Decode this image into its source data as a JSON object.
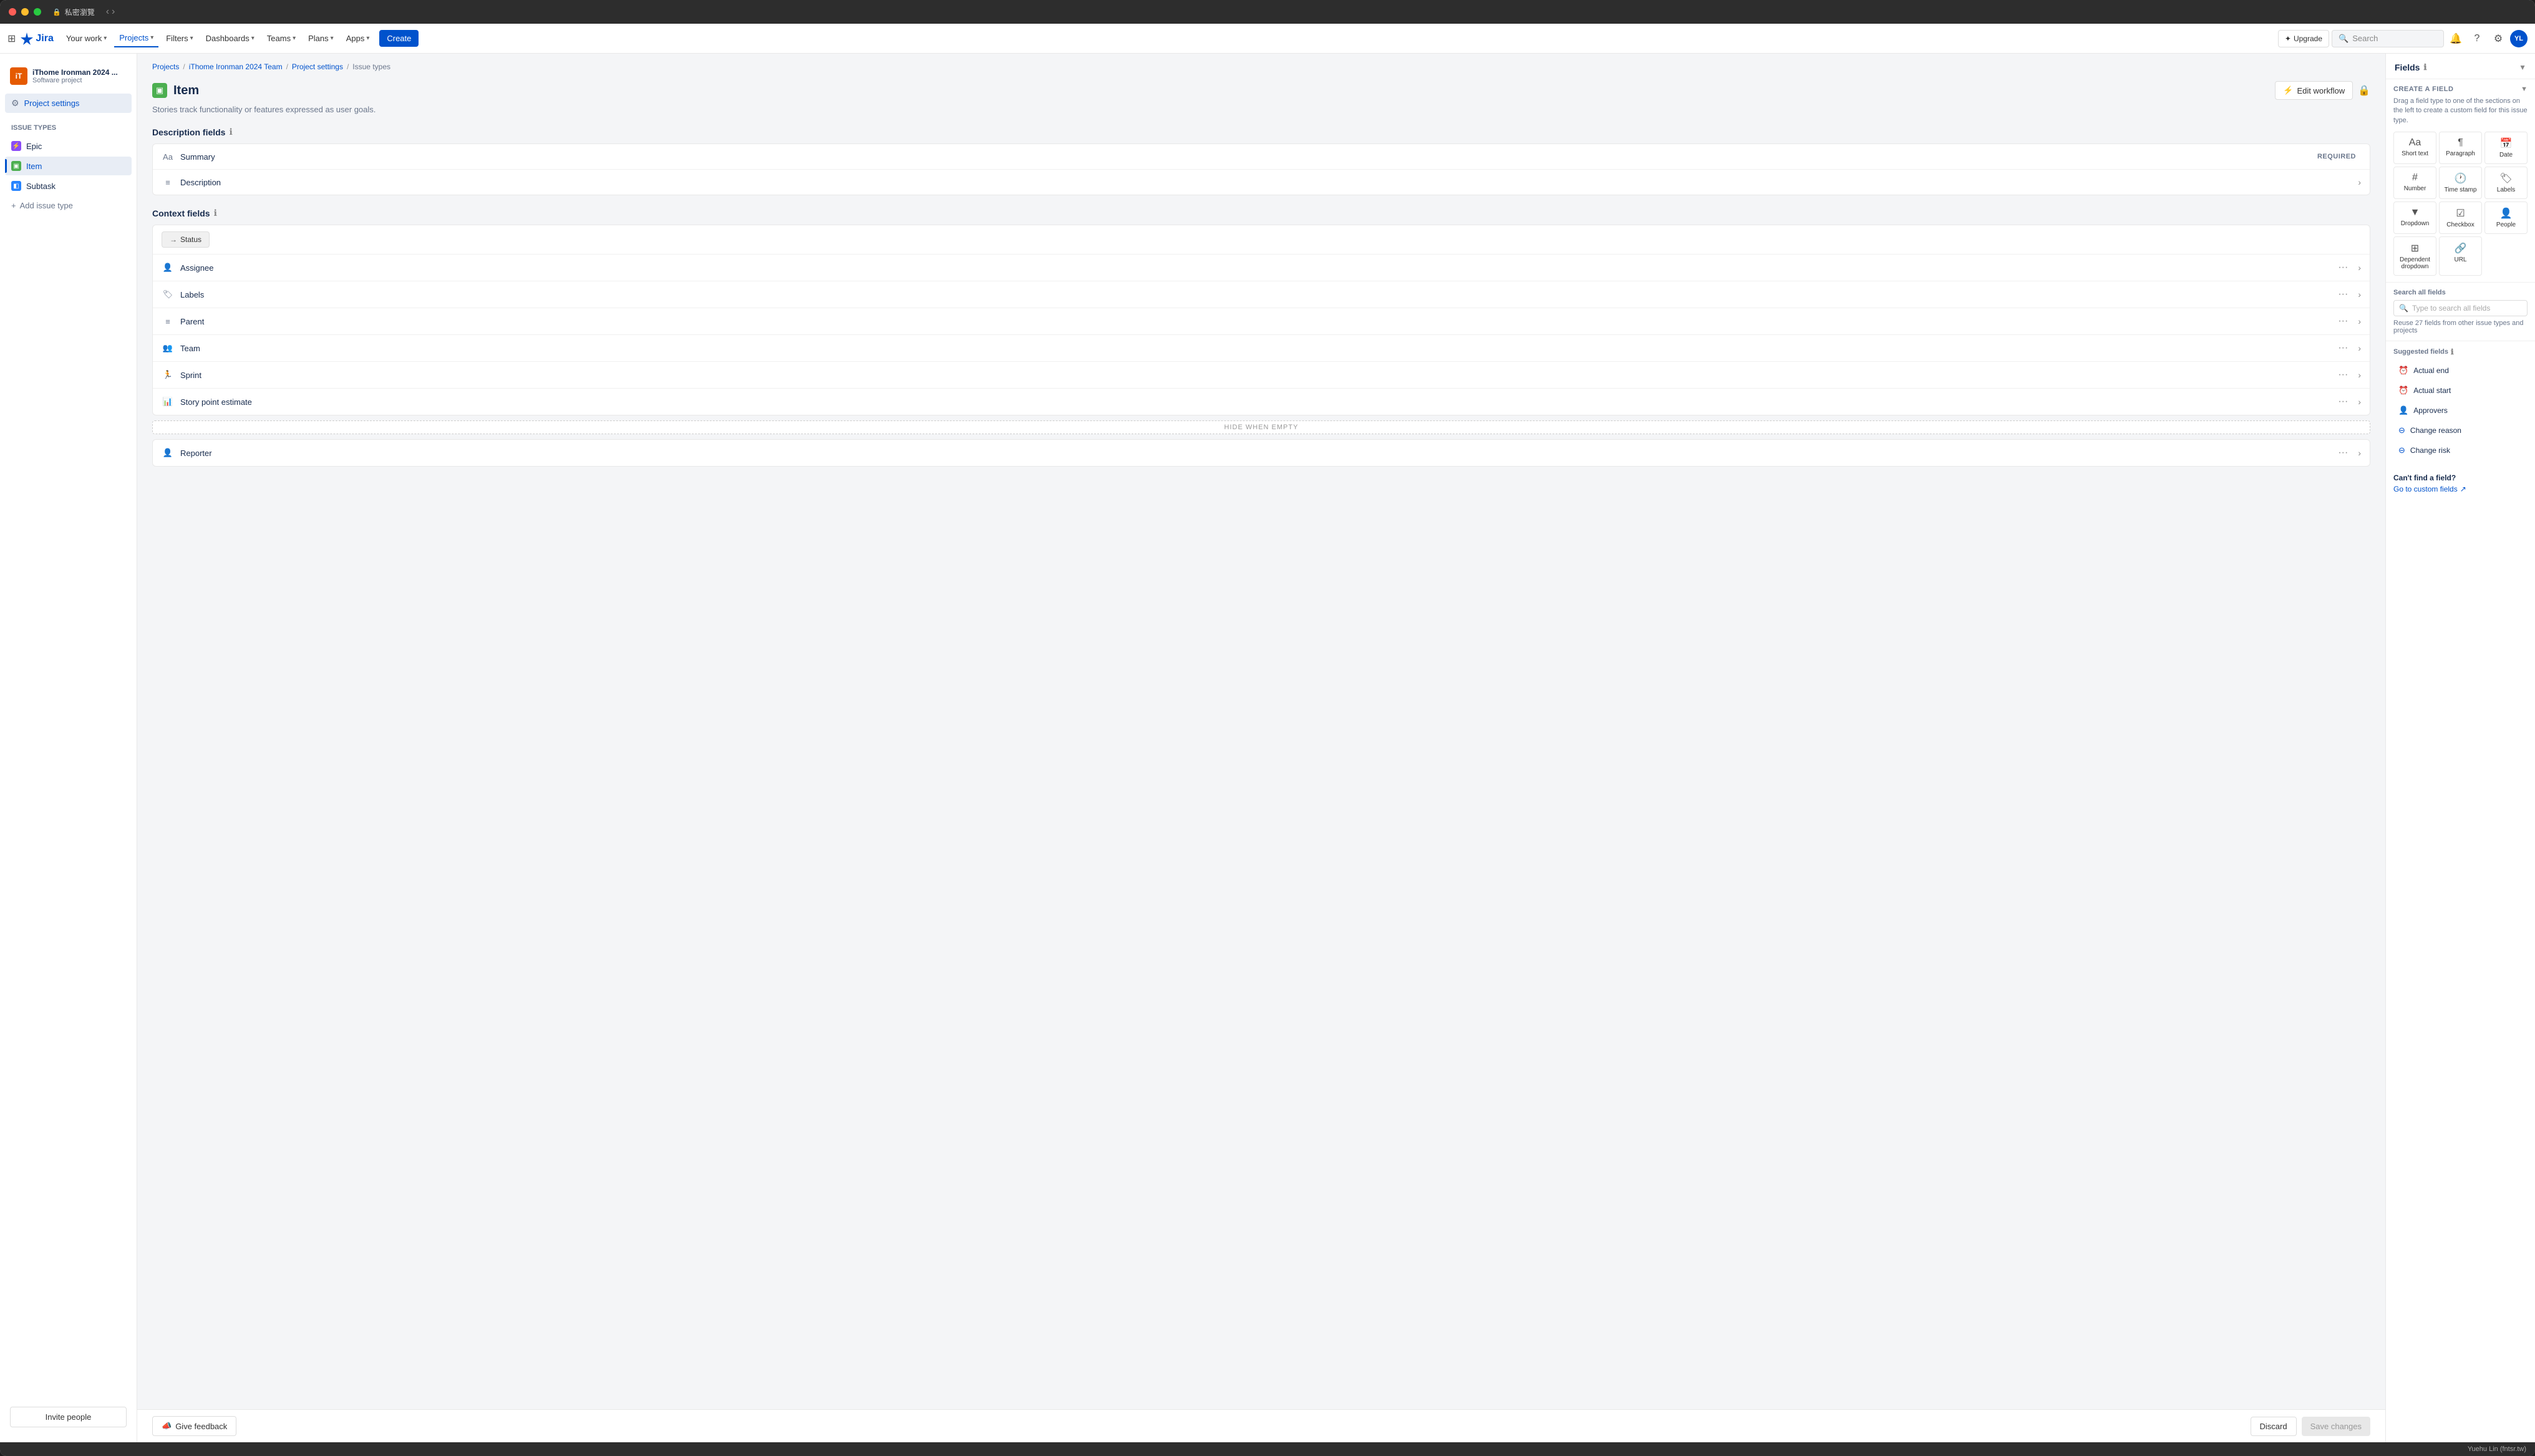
{
  "window": {
    "title": "私密瀏覽",
    "buttons": [
      "close",
      "minimize",
      "maximize"
    ]
  },
  "nav": {
    "logo": "Jira",
    "items": [
      {
        "label": "Your work",
        "hasDropdown": true,
        "active": false
      },
      {
        "label": "Projects",
        "hasDropdown": true,
        "active": true
      },
      {
        "label": "Filters",
        "hasDropdown": true,
        "active": false
      },
      {
        "label": "Dashboards",
        "hasDropdown": true,
        "active": false
      },
      {
        "label": "Teams",
        "hasDropdown": true,
        "active": false
      },
      {
        "label": "Plans",
        "hasDropdown": true,
        "active": false
      },
      {
        "label": "Apps",
        "hasDropdown": true,
        "active": false
      }
    ],
    "create": "Create",
    "upgrade": "Upgrade",
    "search_placeholder": "Search"
  },
  "sidebar": {
    "project_name": "iThome Ironman 2024 ...",
    "project_type": "Software project",
    "nav_item": "Project settings",
    "issue_types_label": "Issue types",
    "issue_types": [
      {
        "label": "Epic",
        "type": "epic"
      },
      {
        "label": "Item",
        "type": "item",
        "active": true
      },
      {
        "label": "Subtask",
        "type": "subtask"
      }
    ],
    "add_issue_type": "Add issue type",
    "invite_people": "Invite people"
  },
  "breadcrumb": {
    "items": [
      "Projects",
      "iThome Ironman 2024 Team",
      "Project settings",
      "Issue types"
    ]
  },
  "page": {
    "title": "Item",
    "description": "Stories track functionality or features expressed as user goals.",
    "edit_workflow": "Edit workflow",
    "description_fields_label": "Description fields",
    "context_fields_label": "Context fields",
    "fields": {
      "description": [
        {
          "icon": "Aa",
          "name": "Summary",
          "required": true
        },
        {
          "icon": "≡",
          "name": "Description",
          "required": false
        }
      ],
      "context": [
        {
          "name": "Status",
          "type": "status"
        },
        {
          "icon": "👤",
          "name": "Assignee"
        },
        {
          "icon": "🏷",
          "name": "Labels"
        },
        {
          "icon": "≡",
          "name": "Parent"
        },
        {
          "icon": "👥",
          "name": "Team"
        },
        {
          "icon": "🏃",
          "name": "Sprint"
        },
        {
          "icon": "📊",
          "name": "Story point estimate"
        }
      ],
      "hide_when_empty": [
        {
          "icon": "👤",
          "name": "Reporter"
        }
      ]
    },
    "hide_when_empty_label": "HIDE WHEN EMPTY"
  },
  "bottom_bar": {
    "give_feedback": "Give feedback",
    "discard": "Discard",
    "save_changes": "Save changes"
  },
  "right_panel": {
    "fields_label": "Fields",
    "create_field_label": "CREATE A FIELD",
    "create_field_desc": "Drag a field type to one of the sections on the left to create a custom field for this issue type.",
    "field_types": [
      {
        "icon": "Aa",
        "label": "Short text"
      },
      {
        "icon": "¶",
        "label": "Paragraph"
      },
      {
        "icon": "📅",
        "label": "Date"
      },
      {
        "icon": "#",
        "label": "Number"
      },
      {
        "icon": "🕐",
        "label": "Time stamp"
      },
      {
        "icon": "🏷",
        "label": "Labels"
      },
      {
        "icon": "▼",
        "label": "Dropdown"
      },
      {
        "icon": "✓",
        "label": "Checkbox"
      },
      {
        "icon": "👤",
        "label": "People"
      },
      {
        "icon": "▼▼",
        "label": "Dependent dropdown"
      },
      {
        "icon": "🔗",
        "label": "URL"
      }
    ],
    "search_fields_label": "Search all fields",
    "search_placeholder": "Type to search all fields",
    "reuse_text": "Reuse 27 fields from other issue types and projects",
    "suggested_label": "Suggested fields",
    "suggested_fields": [
      {
        "label": "Actual end"
      },
      {
        "label": "Actual start"
      },
      {
        "label": "Approvers"
      },
      {
        "label": "Change reason"
      },
      {
        "label": "Change risk"
      }
    ],
    "cant_find_label": "Can't find a field?",
    "go_custom_fields": "Go to custom fields"
  },
  "status_bar": {
    "user": "Yuehu Lin (fntsr.tw)"
  }
}
